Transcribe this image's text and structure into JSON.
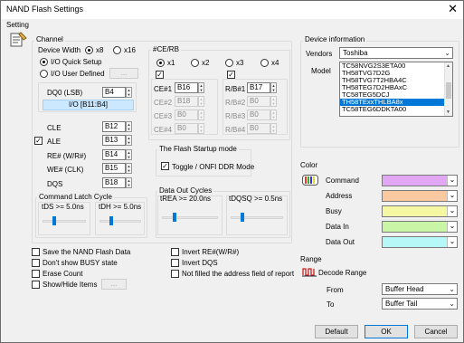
{
  "window": {
    "title": "NAND Flash Settings"
  },
  "tab": {
    "label": "Setting"
  },
  "channel": {
    "title": "Channel",
    "device_width_label": "Device Width",
    "x8_label": "x8",
    "x16_label": "x16",
    "io_quick_label": "I/O Quick Setup",
    "io_user_label": "I/O User Defined",
    "user_btn": "...",
    "dq0_label": "DQ0 (LSB)",
    "dq0_value": "B4",
    "io_range": "I/O [B11:B4]",
    "cle_label": "CLE",
    "cle_value": "B12",
    "ale_label": "ALE",
    "ale_value": "B13",
    "re_label": "RE# (W/R#)",
    "re_value": "B14",
    "we_label": "WE# (CLK)",
    "we_value": "B15",
    "dqs_label": "DQS",
    "dqs_value": "B18"
  },
  "cerb": {
    "title": "#CE/RB",
    "x1": "x1",
    "x2": "x2",
    "x3": "x3",
    "x4": "x4",
    "ce1_label": "CE#1",
    "ce1_value": "B16",
    "ce2_label": "CE#2",
    "ce2_value": "B18",
    "ce3_label": "CE#3",
    "ce3_value": "B0",
    "ce4_label": "CE#4",
    "ce4_value": "B0",
    "rb1_label": "R/B#1",
    "rb1_value": "B17",
    "rb2_label": "R/B#2",
    "rb2_value": "B0",
    "rb3_label": "R/B#3",
    "rb3_value": "B0",
    "rb4_label": "R/B#4",
    "rb4_value": "B0"
  },
  "startup": {
    "title": "The Flash Startup mode",
    "toggle_label": "Toggle / ONFI DDR Mode"
  },
  "latch": {
    "title": "Command Latch Cycle",
    "tds_label": "tDS >= 5.0ns",
    "tdh_label": "tDH >= 5.0ns",
    "tds_level": 0.25,
    "tdh_level": 0.25
  },
  "dataout": {
    "title": "Data Out Cycles",
    "trea_label": "tREA >= 20.0ns",
    "tdqsq_label": "tDQSQ >= 0.5ns",
    "trea_level": 0.2,
    "tdqsq_level": 0.2
  },
  "options": {
    "save_label": "Save the NAND Flash Data",
    "busy_label": "Don't show BUSY state",
    "erase_label": "Erase Count",
    "showhide_label": "Show/Hide Items",
    "showhide_btn": "...",
    "invert_re_label": "Invert RE#(W/R#)",
    "invert_dqs_label": "Invert DQS",
    "notfilled_label": "Not filled the address field of report"
  },
  "device_info": {
    "title": "Device information",
    "vendors_label": "Vendors",
    "vendor_value": "Toshiba",
    "model_label": "Model",
    "models": [
      "TC58NVG2S3ETA00",
      "TH58TVG7D2G",
      "TH58TVG7T2HBA4C",
      "TH58TEG7D2HBAxC",
      "TC58TEG5DCJ",
      "TH58TExxTHLBA8x",
      "TC58TEG6DDKTA00"
    ],
    "selected_index": 5
  },
  "color": {
    "title": "Color",
    "items": [
      {
        "label": "Command",
        "hex": "#e1a7f5"
      },
      {
        "label": "Address",
        "hex": "#fbc9a0"
      },
      {
        "label": "Busy",
        "hex": "#f6f7a2"
      },
      {
        "label": "Data In",
        "hex": "#c9f6a6"
      },
      {
        "label": "Data Out",
        "hex": "#b6f7f7"
      }
    ]
  },
  "range": {
    "title": "Range",
    "decode_label": "Decode Range",
    "from_label": "From",
    "from_value": "Buffer Head",
    "to_label": "To",
    "to_value": "Buffer Tail"
  },
  "buttons": {
    "default": "Default",
    "ok": "OK",
    "cancel": "Cancel"
  }
}
